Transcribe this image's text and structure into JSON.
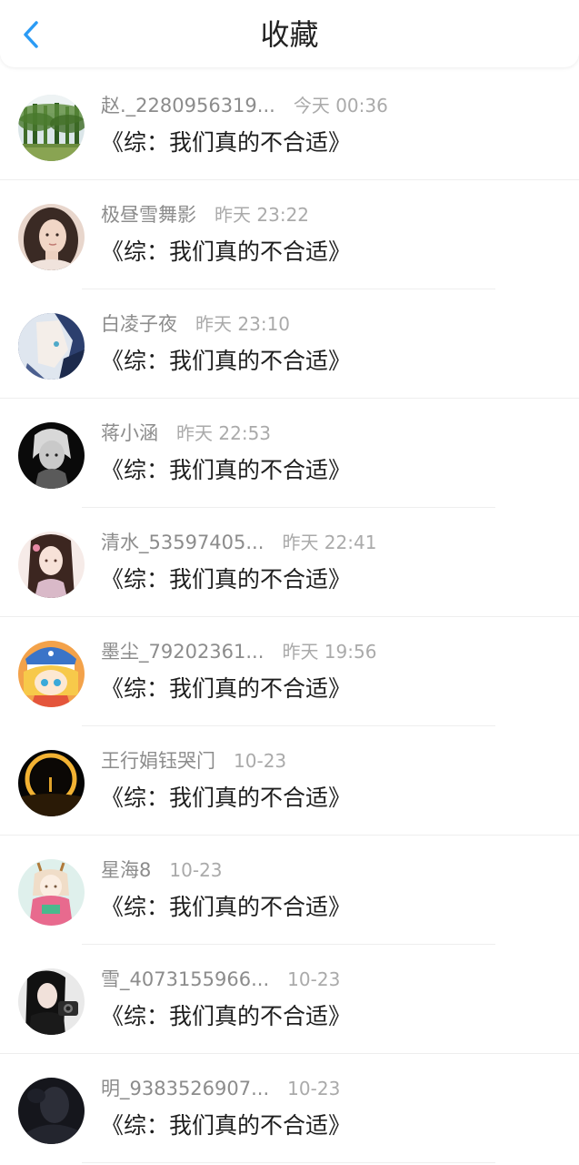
{
  "header": {
    "title": "收藏",
    "back_icon": "chevron-left-icon",
    "accent_color": "#2a9bf5"
  },
  "items": [
    {
      "name": "赵._2280956319...",
      "time": "今天 00:36",
      "title": "《综：我们真的不合适》",
      "avatar": "landscape-bamboo"
    },
    {
      "name": "极昼雪舞影",
      "time": "昨天 23:22",
      "title": "《综：我们真的不合适》",
      "avatar": "girl-portrait"
    },
    {
      "name": "白凌子夜",
      "time": "昨天 23:10",
      "title": "《综：我们真的不合适》",
      "avatar": "anime-white-hair"
    },
    {
      "name": "蒋小涵",
      "time": "昨天 22:53",
      "title": "《综：我们真的不合适》",
      "avatar": "anime-monochrome"
    },
    {
      "name": "清水_53597405...",
      "time": "昨天 22:41",
      "title": "《综：我们真的不合适》",
      "avatar": "anime-long-hair"
    },
    {
      "name": "墨尘_79202361...",
      "time": "昨天 19:56",
      "title": "《综：我们真的不合适》",
      "avatar": "anime-blonde"
    },
    {
      "name": "王行娟钰哭门",
      "time": "10-23",
      "title": "《综：我们真的不合适》",
      "avatar": "eclipse"
    },
    {
      "name": "星海8",
      "time": "10-23",
      "title": "《综：我们真的不合适》",
      "avatar": "anime-deer-girl"
    },
    {
      "name": "雪_4073155966...",
      "time": "10-23",
      "title": "《综：我们真的不合适》",
      "avatar": "girl-camera"
    },
    {
      "name": "明_9383526907...",
      "time": "10-23",
      "title": "《综：我们真的不合适》",
      "avatar": "dark-figure"
    }
  ]
}
